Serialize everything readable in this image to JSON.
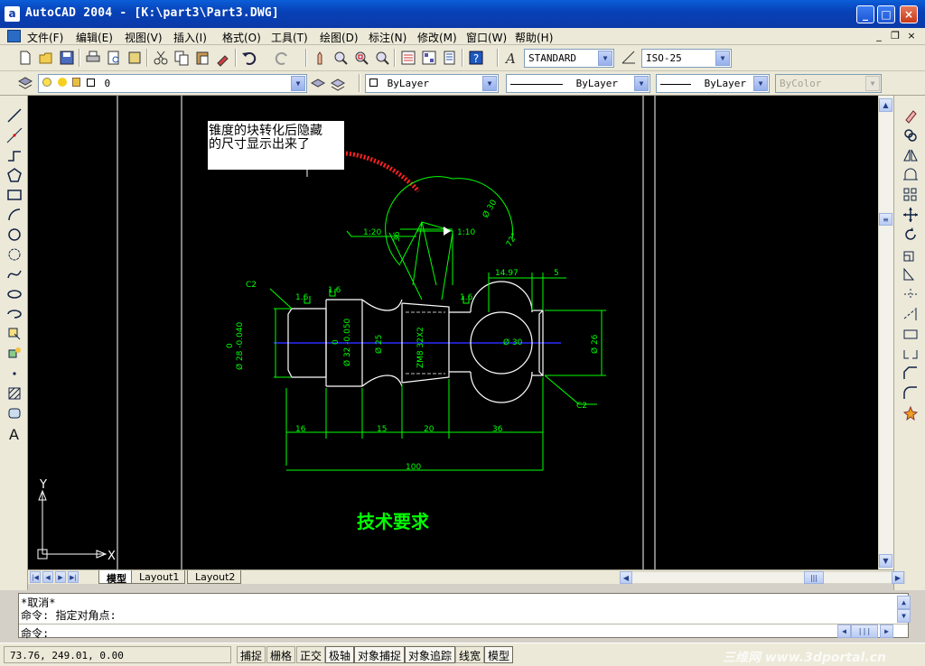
{
  "window": {
    "title": "AutoCAD 2004 - [K:\\part3\\Part3.DWG]",
    "app_icon_letter": "a",
    "minimize": "_",
    "maximize": "□",
    "close": "×"
  },
  "menu": {
    "items": [
      "文件(F)",
      "编辑(E)",
      "视图(V)",
      "插入(I)",
      "格式(O)",
      "工具(T)",
      "绘图(D)",
      "标注(N)",
      "修改(M)",
      "窗口(W)",
      "帮助(H)"
    ],
    "mdi_min": "_",
    "mdi_restore": "❐",
    "mdi_close": "×"
  },
  "toolbar": {
    "text_style": "STANDARD",
    "dim_style": "ISO-25",
    "layer": "0",
    "color": "ByLayer",
    "linetype": "ByLayer",
    "lineweight": "ByLayer",
    "plotstyle": "ByColor"
  },
  "drawing": {
    "note_line1": "锥度的块转化后隐藏",
    "note_line2": "的尺寸显示出来了",
    "dims": {
      "c2_top": "C2",
      "c2_bottom": "C2",
      "rough1": "1.6",
      "rough2": "1.6",
      "rough3": "1.6",
      "taper1": "1:20",
      "taper2": "1:10",
      "d14": "14.97",
      "d5": "5",
      "phi28": "Ø 28 -0.040",
      "phi28_tol": "0",
      "phi32": "Ø 32 -0.050",
      "phi32_tol": "0",
      "phi25": "Ø 25",
      "thread": "ZM8 32X2",
      "phi30": "Ø 30",
      "phi26": "Ø 26",
      "angle": "72°",
      "phi_small": "Ø 30",
      "len16": "16",
      "len15": "15",
      "len20": "20",
      "len36": "36",
      "len100": "100"
    },
    "tech_req": "技术要求",
    "ucs_x": "X",
    "ucs_y": "Y"
  },
  "tabs": [
    "模型",
    "Layout1",
    "Layout2"
  ],
  "command": {
    "line1": "*取消*",
    "line2": "命令: 指定对角点:",
    "prompt": "命令:"
  },
  "status": {
    "coords": "73.76,  249.01, 0.00",
    "buttons": [
      "捕捉",
      "栅格",
      "正交",
      "极轴",
      "对象捕捉",
      "对象追踪",
      "线宽",
      "模型"
    ],
    "watermark": "三维网 www.3dportal.cn"
  },
  "colors": {
    "drawing_bg": "#000000",
    "geometry": "#ffffff",
    "dimensions": "#00ff00",
    "centerline": "#2222ff",
    "annotation_stroke": "#ff2222",
    "titlebar": "#0a49c4"
  }
}
